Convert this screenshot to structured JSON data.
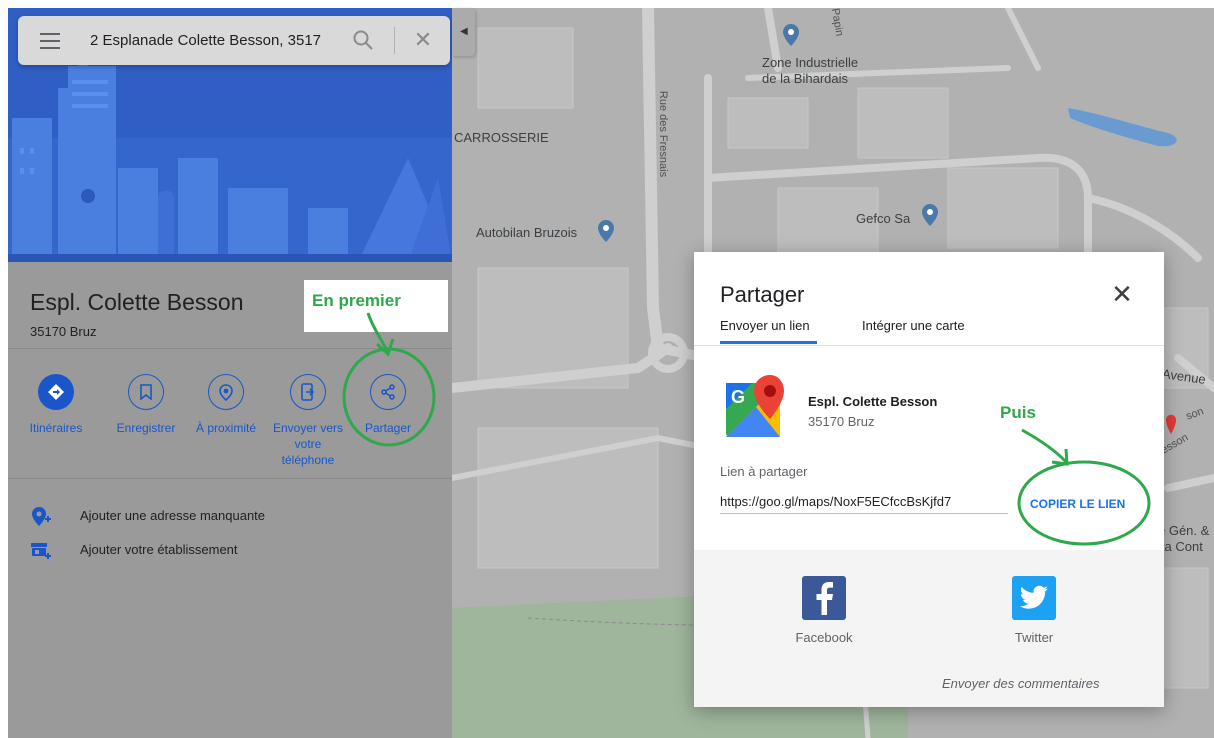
{
  "search": {
    "query": "2 Esplanade Colette Besson, 3517",
    "close_glyph": "✕"
  },
  "place": {
    "name": "Espl. Colette Besson",
    "postal": "35170 Bruz"
  },
  "actions": [
    {
      "label": "Itinéraires",
      "icon": "directions-icon"
    },
    {
      "label": "Enregistrer",
      "icon": "bookmark-icon"
    },
    {
      "label": "À proximité",
      "icon": "nearby-icon"
    },
    {
      "label": "Envoyer vers votre téléphone",
      "icon": "send-to-phone-icon"
    },
    {
      "label": "Partager",
      "icon": "share-icon"
    }
  ],
  "list": [
    {
      "label": "Ajouter une adresse manquante",
      "icon": "add-location-icon"
    },
    {
      "label": "Ajouter votre établissement",
      "icon": "add-business-icon"
    }
  ],
  "annotations": {
    "first": "En premier",
    "then": "Puis",
    "color": "#2fa84b"
  },
  "map": {
    "labels": {
      "zone": "Zone Industrielle",
      "zone2": "de la Bihardais",
      "carrosserie": "CARROSSERIE",
      "autobilan": "Autobilan Bruzois",
      "gefco": "Gefco Sa",
      "avenue": "Avenue",
      "gen": "e Gén. &",
      "cont": "ita Cont",
      "rue_fresnais": "Rue des Fresnais",
      "papin": "s Papin",
      "besson": "esson",
      "son": "son"
    }
  },
  "dialog": {
    "title": "Partager",
    "close_glyph": "✕",
    "tabs": [
      "Envoyer un lien",
      "Intégrer une carte"
    ],
    "place_name": "Espl. Colette Besson",
    "place_sub": "35170 Bruz",
    "link_label": "Lien à partager",
    "link_value": "https://goo.gl/maps/NoxF5ECfccBsKjfd7",
    "copy_label": "COPIER LE LIEN",
    "social": [
      {
        "name": "Facebook",
        "color": "#3b5998",
        "icon": "facebook-icon"
      },
      {
        "name": "Twitter",
        "color": "#1da1f2",
        "icon": "twitter-icon"
      }
    ],
    "feedback": "Envoyer des commentaires"
  },
  "colors": {
    "accent": "#1a56c9",
    "link_blue": "#1a73e8",
    "hero": "#2f5ec4"
  }
}
